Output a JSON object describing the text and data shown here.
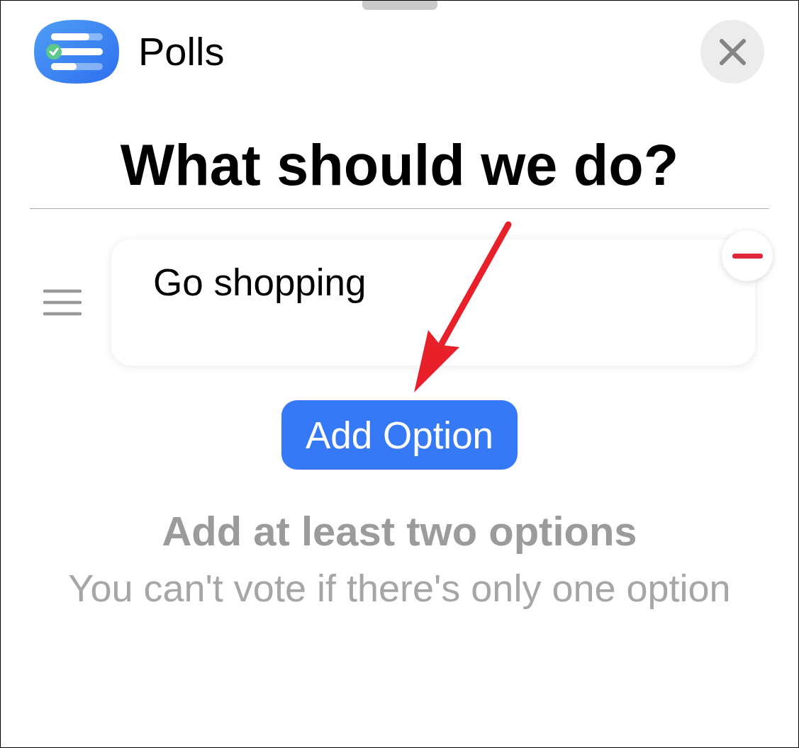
{
  "sheet": {
    "app_name": "Polls"
  },
  "poll": {
    "question": "What should we do?",
    "options": [
      {
        "text": "Go shopping"
      }
    ],
    "add_button": "Add Option"
  },
  "hint": {
    "title": "Add at least two options",
    "subtitle": "You can't vote if there's only one option"
  }
}
